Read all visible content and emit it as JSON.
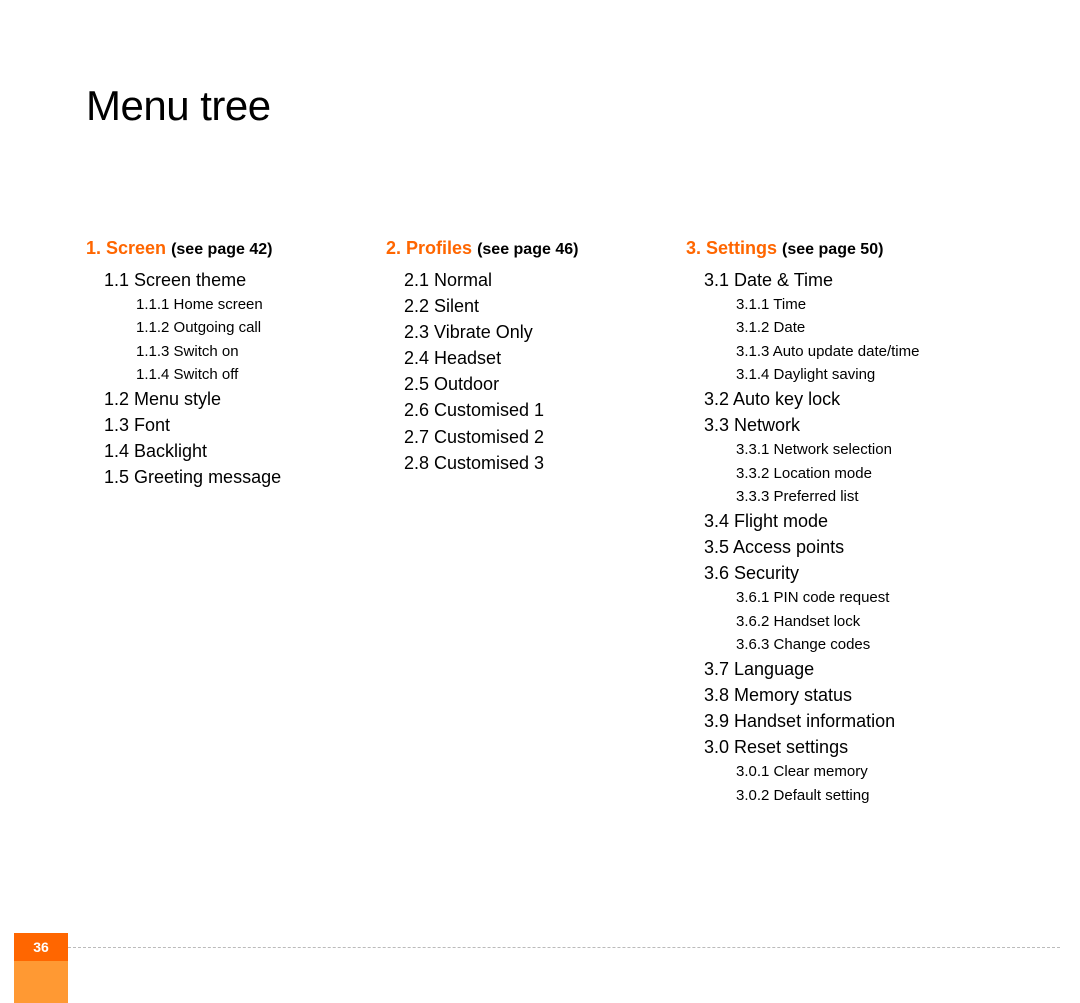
{
  "title": "Menu tree",
  "page_number": "36",
  "columns": [
    {
      "header_num": "1. Screen",
      "header_ref": "(see page 42)",
      "items": [
        {
          "lvl": 1,
          "text": "1.1 Screen theme"
        },
        {
          "lvl": 2,
          "text": "1.1.1 Home screen"
        },
        {
          "lvl": 2,
          "text": "1.1.2 Outgoing call"
        },
        {
          "lvl": 2,
          "text": "1.1.3 Switch on"
        },
        {
          "lvl": 2,
          "text": "1.1.4 Switch off"
        },
        {
          "lvl": 1,
          "text": "1.2 Menu style"
        },
        {
          "lvl": 1,
          "text": "1.3 Font"
        },
        {
          "lvl": 1,
          "text": "1.4 Backlight"
        },
        {
          "lvl": 1,
          "text": "1.5 Greeting message"
        }
      ]
    },
    {
      "header_num": "2. Profiles",
      "header_ref": "(see page 46)",
      "items": [
        {
          "lvl": 1,
          "text": "2.1 Normal"
        },
        {
          "lvl": 1,
          "text": "2.2 Silent"
        },
        {
          "lvl": 1,
          "text": "2.3 Vibrate Only"
        },
        {
          "lvl": 1,
          "text": "2.4 Headset"
        },
        {
          "lvl": 1,
          "text": "2.5 Outdoor"
        },
        {
          "lvl": 1,
          "text": "2.6 Customised 1"
        },
        {
          "lvl": 1,
          "text": "2.7 Customised 2"
        },
        {
          "lvl": 1,
          "text": "2.8 Customised 3"
        }
      ]
    },
    {
      "header_num": "3. Settings",
      "header_ref": "(see page 50)",
      "items": [
        {
          "lvl": 1,
          "text": "3.1 Date & Time"
        },
        {
          "lvl": 2,
          "text": "3.1.1 Time"
        },
        {
          "lvl": 2,
          "text": "3.1.2 Date"
        },
        {
          "lvl": 2,
          "text": "3.1.3 Auto update date/time"
        },
        {
          "lvl": 2,
          "text": "3.1.4 Daylight saving"
        },
        {
          "lvl": 1,
          "text": "3.2 Auto key lock"
        },
        {
          "lvl": 1,
          "text": "3.3 Network"
        },
        {
          "lvl": 2,
          "text": "3.3.1 Network selection"
        },
        {
          "lvl": 2,
          "text": "3.3.2 Location mode"
        },
        {
          "lvl": 2,
          "text": "3.3.3 Preferred list"
        },
        {
          "lvl": 1,
          "text": "3.4 Flight mode"
        },
        {
          "lvl": 1,
          "text": "3.5 Access points"
        },
        {
          "lvl": 1,
          "text": "3.6 Security"
        },
        {
          "lvl": 2,
          "text": "3.6.1 PIN code request"
        },
        {
          "lvl": 2,
          "text": "3.6.2 Handset lock"
        },
        {
          "lvl": 2,
          "text": "3.6.3 Change codes"
        },
        {
          "lvl": 1,
          "text": "3.7 Language"
        },
        {
          "lvl": 1,
          "text": "3.8 Memory status"
        },
        {
          "lvl": 1,
          "text": "3.9 Handset information"
        },
        {
          "lvl": 1,
          "text": "3.0 Reset settings"
        },
        {
          "lvl": 2,
          "text": "3.0.1 Clear memory"
        },
        {
          "lvl": 2,
          "text": "3.0.2 Default setting"
        }
      ]
    }
  ]
}
